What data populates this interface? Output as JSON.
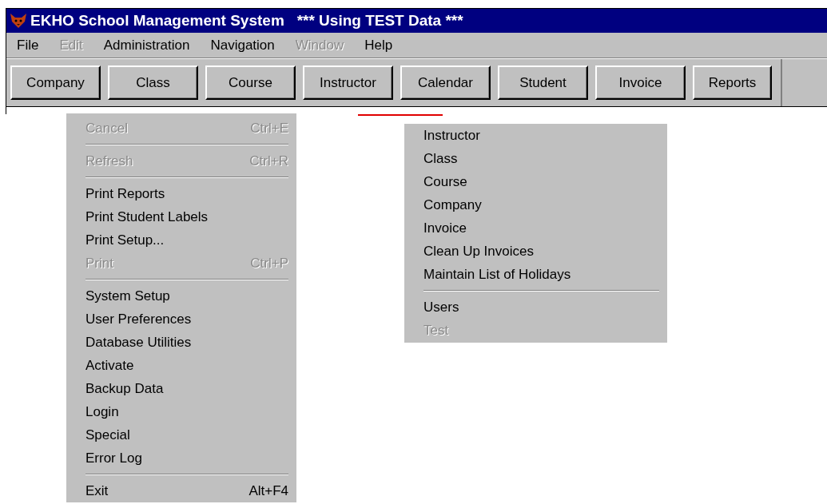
{
  "window": {
    "title": "EKHO School Management System   *** Using TEST Data ***"
  },
  "menu_bar": [
    {
      "label": "File",
      "disabled": false
    },
    {
      "label": "Edit",
      "disabled": true
    },
    {
      "label": "Administration",
      "disabled": false
    },
    {
      "label": "Navigation",
      "disabled": false
    },
    {
      "label": "Window",
      "disabled": true
    },
    {
      "label": "Help",
      "disabled": false
    }
  ],
  "toolbar": [
    {
      "label": "Company"
    },
    {
      "label": "Class"
    },
    {
      "label": "Course"
    },
    {
      "label": "Instructor"
    },
    {
      "label": "Calendar"
    },
    {
      "label": "Student"
    },
    {
      "label": "Invoice"
    },
    {
      "label": "Reports"
    }
  ],
  "menus": [
    {
      "items": [
        {
          "kind": "item",
          "label": "Cancel",
          "shortcut": "Ctrl+E",
          "disabled": true
        },
        {
          "kind": "separator"
        },
        {
          "kind": "item",
          "label": "Refresh",
          "shortcut": "Ctrl+R",
          "disabled": true
        },
        {
          "kind": "separator"
        },
        {
          "kind": "item",
          "label": "Print Reports",
          "disabled": false
        },
        {
          "kind": "item",
          "label": "Print Student Labels",
          "disabled": false
        },
        {
          "kind": "item",
          "label": "Print Setup...",
          "disabled": false
        },
        {
          "kind": "item",
          "label": "Print",
          "shortcut": "Ctrl+P",
          "disabled": true
        },
        {
          "kind": "separator"
        },
        {
          "kind": "item",
          "label": "System Setup",
          "disabled": false
        },
        {
          "kind": "item",
          "label": "User Preferences",
          "disabled": false
        },
        {
          "kind": "item",
          "label": "Database Utilities",
          "disabled": false
        },
        {
          "kind": "item",
          "label": "Activate",
          "disabled": false
        },
        {
          "kind": "item",
          "label": "Backup Data",
          "disabled": false
        },
        {
          "kind": "item",
          "label": "Login",
          "disabled": false
        },
        {
          "kind": "item",
          "label": "Special",
          "disabled": false
        },
        {
          "kind": "item",
          "label": "Error Log",
          "disabled": false
        },
        {
          "kind": "separator"
        },
        {
          "kind": "item",
          "label": "Exit",
          "shortcut": "Alt+F4",
          "disabled": false
        }
      ]
    },
    {
      "items": [
        {
          "kind": "item",
          "label": "Instructor",
          "disabled": false
        },
        {
          "kind": "item",
          "label": "Class",
          "disabled": false
        },
        {
          "kind": "item",
          "label": "Course",
          "disabled": false
        },
        {
          "kind": "item",
          "label": "Company",
          "disabled": false
        },
        {
          "kind": "item",
          "label": "Invoice",
          "disabled": false
        },
        {
          "kind": "item",
          "label": "Clean Up Invoices",
          "disabled": false
        },
        {
          "kind": "item",
          "label": "Maintain List of Holidays",
          "disabled": false
        },
        {
          "kind": "separator"
        },
        {
          "kind": "item",
          "label": "Users",
          "disabled": false
        },
        {
          "kind": "item",
          "label": "Test",
          "disabled": true
        }
      ]
    }
  ]
}
